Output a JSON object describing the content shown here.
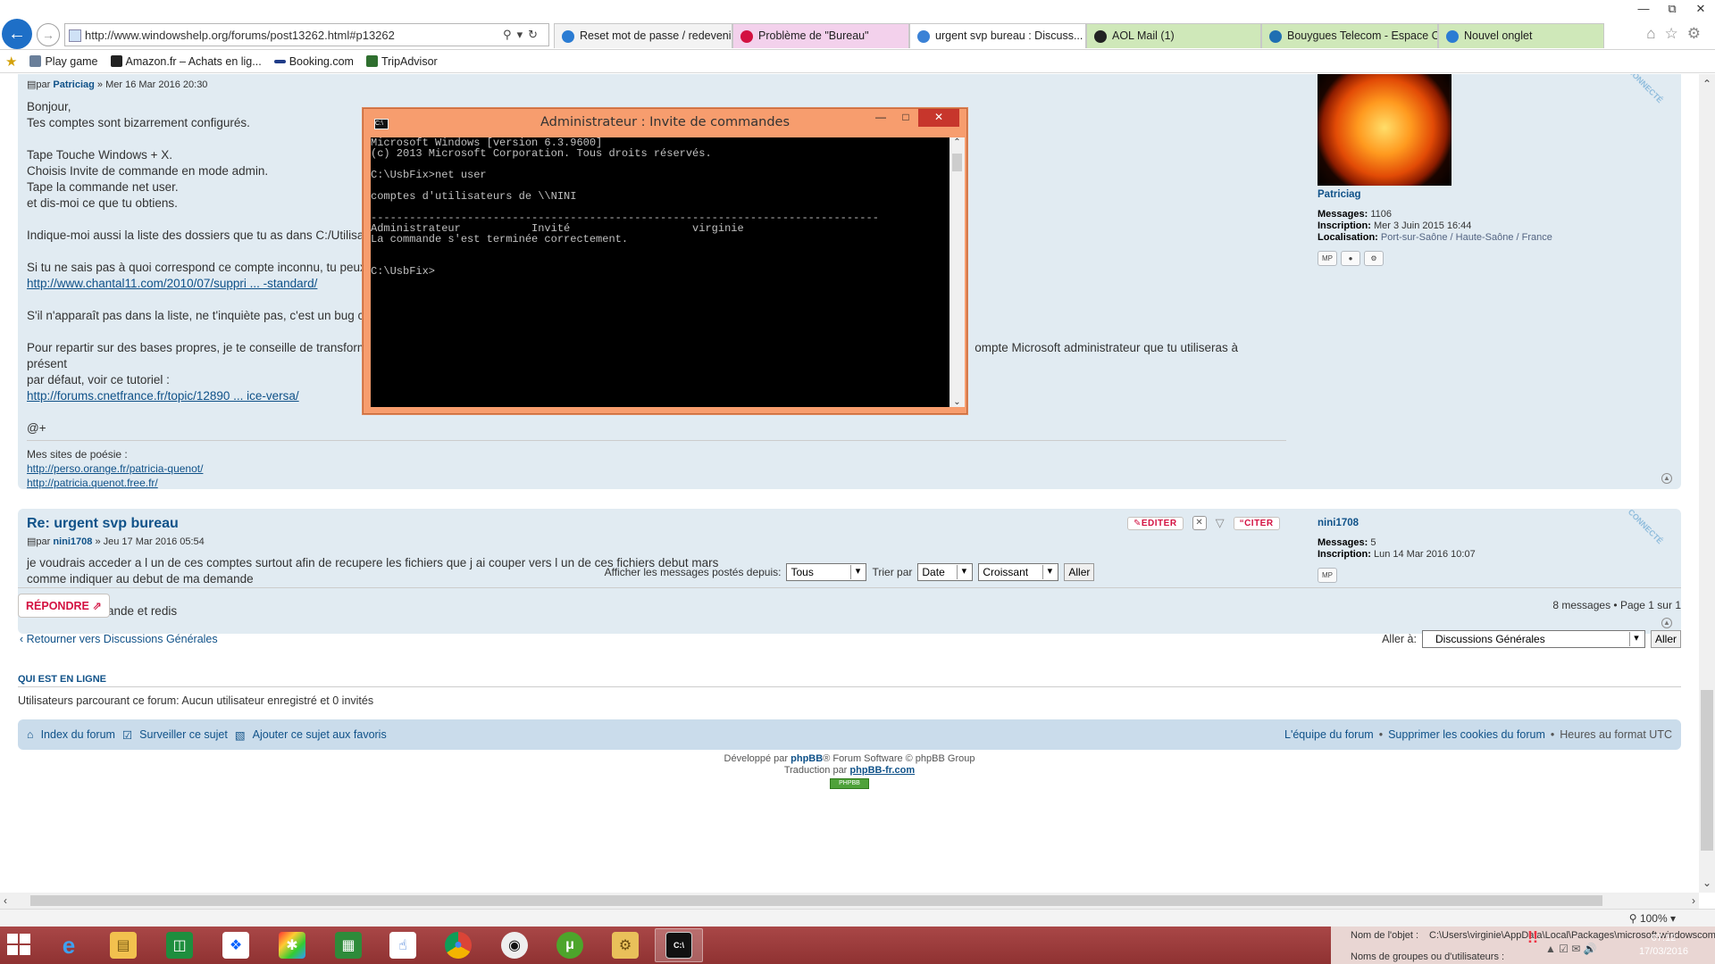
{
  "browser": {
    "address": "http://www.windowshelp.org/forums/post13262.html#p13262",
    "tabs": [
      {
        "label": "Reset mot de passe / redevenir...",
        "color": "#2b7cd3",
        "style": "normal"
      },
      {
        "label": "Problème de \"Bureau\"",
        "color": "#d31141",
        "style": "pink"
      },
      {
        "label": "urgent svp bureau : Discuss...",
        "color": "#3b82d6",
        "style": "active"
      },
      {
        "label": "AOL Mail (1)",
        "color": "#222222",
        "style": "green"
      },
      {
        "label": "Bouygues Telecom - Espace C...",
        "color": "#1f6fb2",
        "style": "green"
      },
      {
        "label": "Nouvel onglet",
        "color": "#2b7cd3",
        "style": "green"
      }
    ],
    "favorites": [
      "Play game",
      "Amazon.fr – Achats en lig...",
      "Booking.com",
      "TripAdvisor"
    ]
  },
  "post1": {
    "author_prefix": "par",
    "author": "Patriciag",
    "date": "» Mer 16 Mar 2016 20:30",
    "lines": [
      "Bonjour,",
      "Tes comptes sont bizarrement configurés.",
      "",
      "Tape Touche Windows + X.",
      "Choisis Invite de commande en mode admin.",
      "Tape la commande net user.",
      "et dis-moi ce que tu obtiens.",
      "",
      "Indique-moi aussi la liste des dossiers que tu as dans C:/Utilisate",
      "",
      "Si tu ne sais pas à quoi correspond ce compte inconnu, tu peux l"
    ],
    "link1": "http://www.chantal11.com/2010/07/suppri ... -standard/",
    "line_bug": "S'il n'apparaît pas dans la liste, ne t'inquiète pas, c'est un bug co",
    "line_repartir_a": "Pour repartir sur des bases propres, je te conseille de transform",
    "line_repartir_b": "ompte Microsoft administrateur que tu utiliseras à présent",
    "line_defaut": "par défaut, voir ce tutoriel :",
    "link2": "http://forums.cnetfrance.fr/topic/12890 ... ice-versa/",
    "closing": "@+",
    "sig_title": "Mes sites de poésie :",
    "sig_link1": "http://perso.orange.fr/patricia-quenot/",
    "sig_link2": "http://patricia.quenot.free.fr/",
    "profile": {
      "name": "Patriciag",
      "messages_label": "Messages:",
      "messages": "1106",
      "inscription_label": "Inscription:",
      "inscription": "Mer 3 Juin 2015 16:44",
      "localisation_label": "Localisation:",
      "localisation": "Port-sur-Saône / Haute-Saône / France",
      "online": "CONNECTÉ"
    }
  },
  "post2": {
    "title": "Re: urgent svp bureau",
    "author_prefix": "par",
    "author": "nini1708",
    "date": "» Jeu 17 Mar 2016 05:54",
    "lines": [
      "je voudrais acceder a l un de ces comptes surtout afin de recupere les fichiers que j ai couper vers l un de ces fichiers debut mars",
      "comme indiquer au debut de ma demande",
      "",
      "je fais la commande et redis"
    ],
    "buttons": {
      "edit": "EDITER",
      "quote": "CITER"
    },
    "profile": {
      "name": "nini1708",
      "messages_label": "Messages:",
      "messages": "5",
      "inscription_label": "Inscription:",
      "inscription": "Lun 14 Mar 2016 10:07",
      "online": "CONNECTÉ"
    }
  },
  "sort": {
    "label_display": "Afficher les messages postés depuis:",
    "display_value": "Tous",
    "label_sort": "Trier par",
    "sort_value": "Date",
    "order_value": "Croissant",
    "go": "Aller"
  },
  "reply": "RÉPONDRE",
  "pagination": "8 messages • Page 1 sur 1",
  "return_link": "Retourner vers Discussions Générales",
  "jump": {
    "label": "Aller à:",
    "value": "Discussions Générales",
    "go": "Aller"
  },
  "who": {
    "title": "QUI EST EN LIGNE",
    "text": "Utilisateurs parcourant ce forum: Aucun utilisateur enregistré et 0 invités"
  },
  "footer_nav": {
    "index": "Index du forum",
    "watch": "Surveiller ce sujet",
    "bookmark": "Ajouter ce sujet aux favoris",
    "team": "L'équipe du forum",
    "cookies": "Supprimer les cookies du forum",
    "tz": "Heures au format UTC"
  },
  "credits": {
    "line1_a": "Développé par",
    "line1_b": "phpBB",
    "line1_c": "® Forum Software © phpBB Group",
    "line2_a": "Traduction par",
    "line2_b": "phpBB-fr.com",
    "badge": "PHPBB SEO.COM"
  },
  "status": {
    "zoom": "100%"
  },
  "cmd": {
    "title": "Administrateur : Invite de commandes",
    "output": "Microsoft Windows [version 6.3.9600]\n(c) 2013 Microsoft Corporation. Tous droits réservés.\n\nC:\\UsbFix>net user\n\ncomptes d'utilisateurs de \\\\NINI\n\n-------------------------------------------------------------------------------\nAdministrateur           Invité                   virginie\nLa commande s'est terminée correctement.\n\n\nC:\\UsbFix>"
  },
  "taskbar": {
    "clock_time": "07:12",
    "clock_date": "17/03/2016",
    "notif_line1_label": "Nom de l'objet :",
    "notif_line1_value": "C:\\Users\\virginie\\AppData\\Local\\Packages\\microsoft.windowscom",
    "notif_line2_label": "Noms de groupes ou d'utilisateurs :"
  }
}
